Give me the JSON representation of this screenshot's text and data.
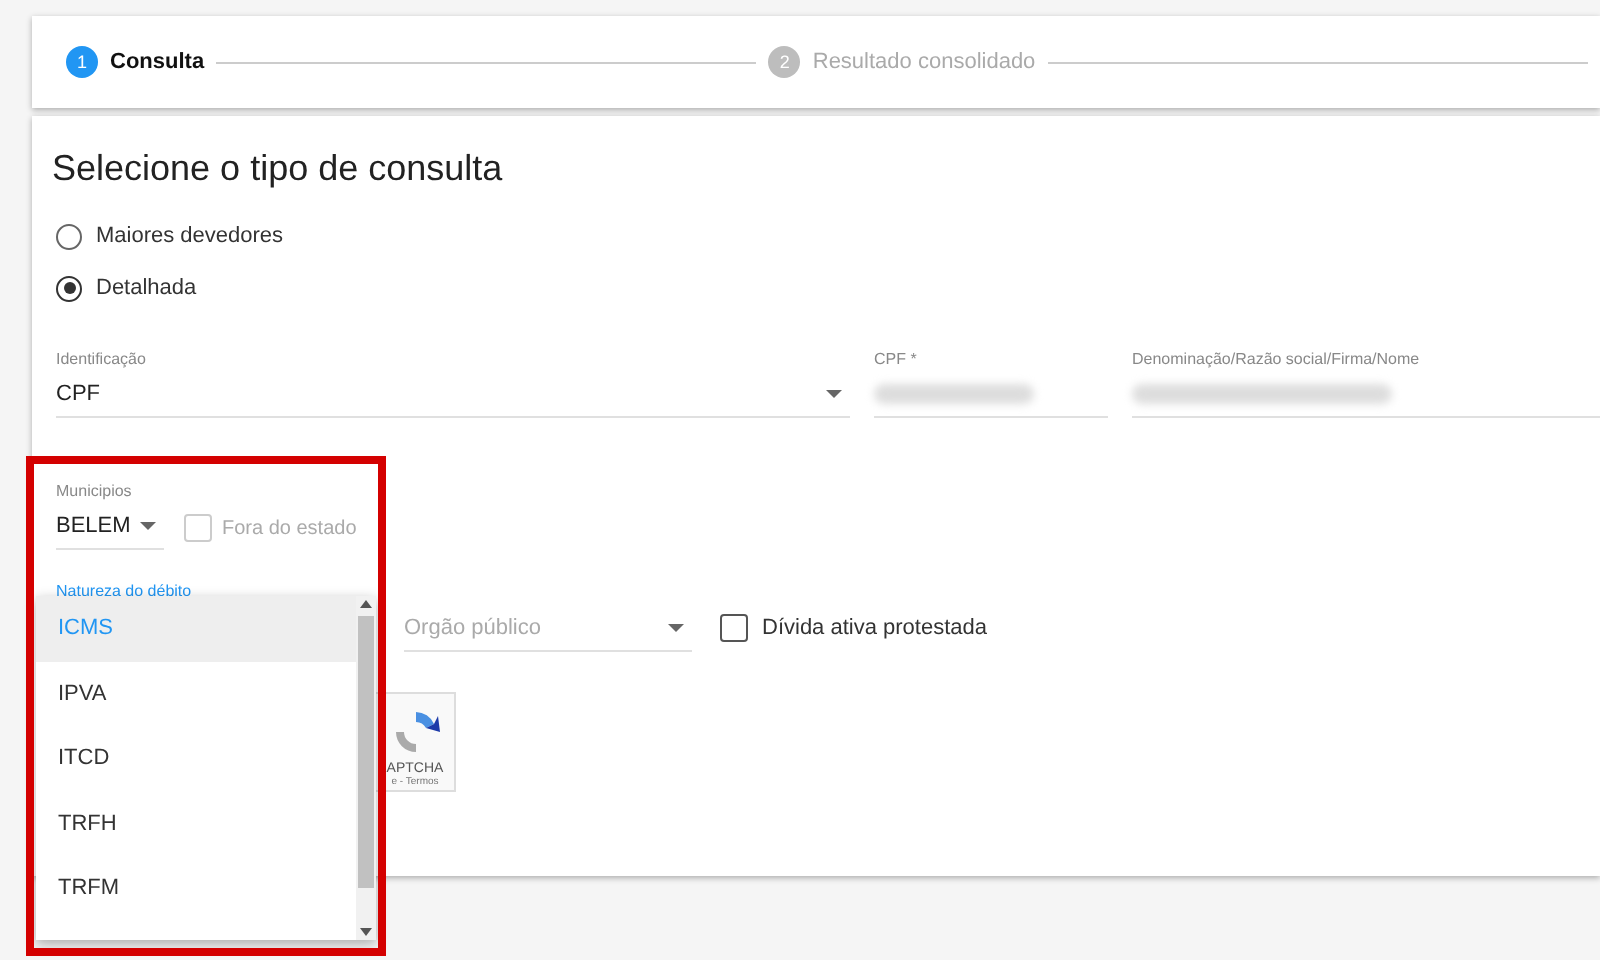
{
  "stepper": {
    "steps": [
      {
        "number": "1",
        "label": "Consulta",
        "selected": true
      },
      {
        "number": "2",
        "label": "Resultado consolidado",
        "selected": false
      }
    ]
  },
  "form": {
    "title": "Selecione o tipo de consulta",
    "query_types": [
      {
        "label": "Maiores devedores",
        "selected": false
      },
      {
        "label": "Detalhada",
        "selected": true
      }
    ],
    "identificacao": {
      "label": "Identificação",
      "value": "CPF"
    },
    "cpf": {
      "label": "CPF *"
    },
    "denominacao": {
      "label": "Denominação/Razão social/Firma/Nome"
    },
    "municipios": {
      "label": "Municipios",
      "value": "BELEM"
    },
    "fora_do_estado": {
      "label": "Fora do estado",
      "checked": false,
      "disabled": true
    },
    "natureza": {
      "label": "Natureza do débito",
      "menu": [
        {
          "label": "ICMS",
          "selected": true
        },
        {
          "label": "IPVA",
          "selected": false
        },
        {
          "label": "ITCD",
          "selected": false
        },
        {
          "label": "TRFH",
          "selected": false
        },
        {
          "label": "TRFM",
          "selected": false
        }
      ]
    },
    "orgao": {
      "placeholder": "Orgão público"
    },
    "divida_protestada": {
      "label": "Dívida ativa protestada",
      "checked": false
    },
    "captcha": {
      "texts": [
        "APTCHA",
        "e - Termos"
      ]
    }
  }
}
